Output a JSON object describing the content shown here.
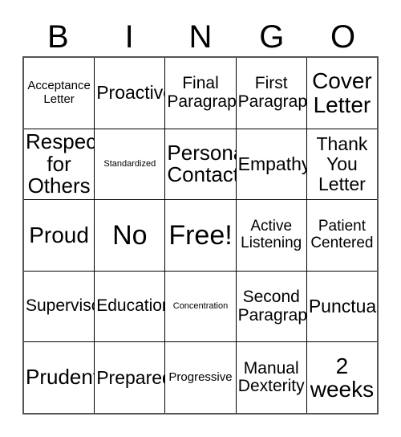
{
  "card": {
    "headers": [
      "B",
      "I",
      "N",
      "G",
      "O"
    ],
    "rows": [
      [
        {
          "text": "Acceptance\nLetter",
          "size": "sz-sm"
        },
        {
          "text": "Proactive",
          "size": "sz-2xl"
        },
        {
          "text": "Final\nParagraph",
          "size": "sz-xl"
        },
        {
          "text": "First\nParagraph",
          "size": "sz-xl"
        },
        {
          "text": "Cover\nLetter",
          "size": "sz-4xl"
        }
      ],
      [
        {
          "text": "Respect\nfor\nOthers",
          "size": "sz-3xl"
        },
        {
          "text": "Standardized",
          "size": "sz-xs"
        },
        {
          "text": "Personal\nContacts",
          "size": "sz-3xl"
        },
        {
          "text": "Empathy",
          "size": "sz-2xl"
        },
        {
          "text": "Thank\nYou\nLetter",
          "size": "sz-2xl"
        }
      ],
      [
        {
          "text": "Proud",
          "size": "sz-4xl"
        },
        {
          "text": "No",
          "size": "sz-5xl"
        },
        {
          "text": "Free!",
          "size": "sz-5xl"
        },
        {
          "text": "Active\nListening",
          "size": "sz-lg"
        },
        {
          "text": "Patient\nCentered",
          "size": "sz-lg"
        }
      ],
      [
        {
          "text": "Supervisor",
          "size": "sz-xl"
        },
        {
          "text": "Education",
          "size": "sz-xl"
        },
        {
          "text": "Concentration",
          "size": "sz-xs"
        },
        {
          "text": "Second\nParagraph",
          "size": "sz-xl"
        },
        {
          "text": "Punctual",
          "size": "sz-2xl"
        }
      ],
      [
        {
          "text": "Prudent",
          "size": "sz-3xl"
        },
        {
          "text": "Prepared",
          "size": "sz-2xl"
        },
        {
          "text": "Progressive",
          "size": "sz-sm"
        },
        {
          "text": "Manual\nDexterity",
          "size": "sz-xl"
        },
        {
          "text": "2\nweeks",
          "size": "sz-4xl"
        }
      ]
    ]
  },
  "colors": {
    "text": "#000000",
    "background": "#ffffff",
    "grid_line": "#000000",
    "outer_border": "#555555"
  }
}
